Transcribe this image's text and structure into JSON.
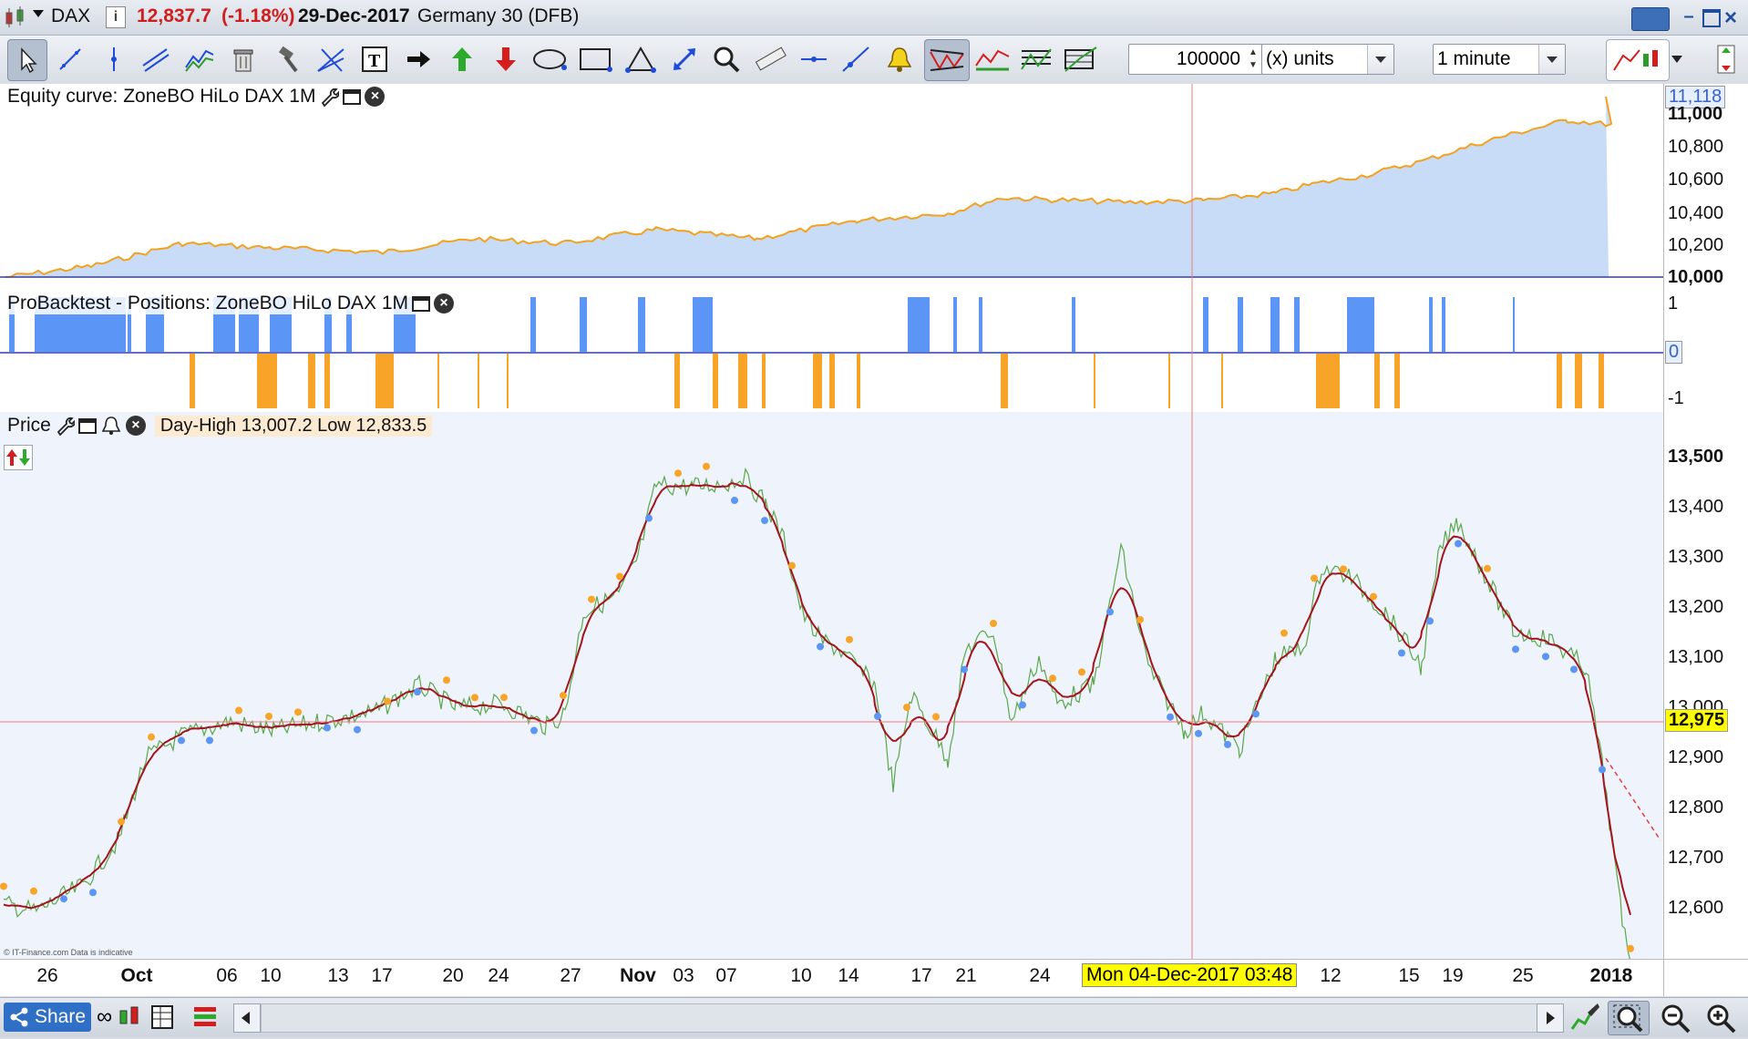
{
  "titlebar": {
    "symbol": "DAX",
    "price": "12,837.7",
    "change": "(-1.18%)",
    "date": "29-Dec-2017",
    "instrument": "Germany 30 (DFB)"
  },
  "toolbar": {
    "quantity_value": "100000",
    "units_label": "(x) units",
    "timeframe": "1 minute"
  },
  "equity_panel": {
    "title": "Equity curve: ZoneBO HiLo DAX 1M",
    "current_value": "11,118",
    "y_ticks": [
      "11,000",
      "10,800",
      "10,600",
      "10,400",
      "10,200",
      "10,000"
    ]
  },
  "positions_panel": {
    "title": "ProBacktest - Positions: ZoneBO HiLo DAX 1M",
    "y_ticks": [
      "1",
      "0",
      "-1"
    ]
  },
  "price_panel": {
    "title": "Price",
    "overlay_text": "Day-High 13,007.2 Low 12,833.5",
    "current_price": "12,975",
    "y_ticks": [
      "13,500",
      "13,400",
      "13,300",
      "13,200",
      "13,100",
      "13,000",
      "12,900",
      "12,800",
      "12,700",
      "12,600"
    ],
    "watermark": "© IT-Finance.com Data is indicative"
  },
  "x_axis": {
    "labels": [
      {
        "text": "26",
        "bold": false
      },
      {
        "text": "Oct",
        "bold": true
      },
      {
        "text": "06",
        "bold": false
      },
      {
        "text": "10",
        "bold": false
      },
      {
        "text": "13",
        "bold": false
      },
      {
        "text": "17",
        "bold": false
      },
      {
        "text": "20",
        "bold": false
      },
      {
        "text": "24",
        "bold": false
      },
      {
        "text": "27",
        "bold": false
      },
      {
        "text": "Nov",
        "bold": true
      },
      {
        "text": "03",
        "bold": false
      },
      {
        "text": "07",
        "bold": false
      },
      {
        "text": "10",
        "bold": false
      },
      {
        "text": "14",
        "bold": false
      },
      {
        "text": "17",
        "bold": false
      },
      {
        "text": "21",
        "bold": false
      },
      {
        "text": "24",
        "bold": false
      },
      {
        "text": "12",
        "bold": false
      },
      {
        "text": "15",
        "bold": false
      },
      {
        "text": "19",
        "bold": false
      },
      {
        "text": "25",
        "bold": false
      },
      {
        "text": "2018",
        "bold": true
      }
    ],
    "crosshair_label": "Mon 04-Dec-2017 03:48"
  },
  "bottombar": {
    "share_label": "Share"
  },
  "colors": {
    "equity_fill": "#c9dcf7",
    "equity_line": "#f4a11d",
    "long_position": "#5b95f5",
    "short_position": "#f8a428",
    "price_line": "#5aa84a",
    "ma_line": "#a3141c",
    "crosshair": "#f07b7b",
    "price_tag": "#ffff00"
  }
}
